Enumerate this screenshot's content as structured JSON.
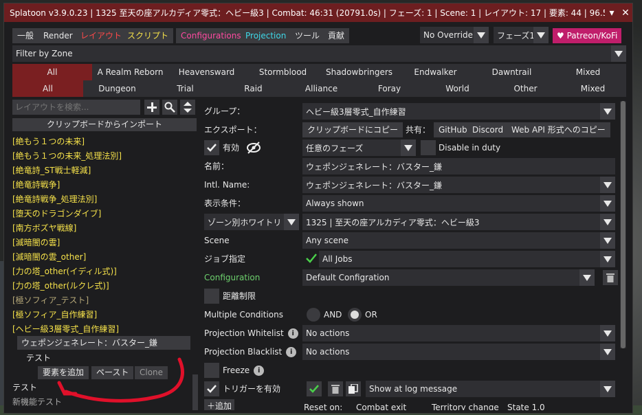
{
  "window": {
    "title": "Splatoon v3.9.0.23 | 1325 至天の座アルカディア零式：ヘビー級3 | Combat: 46:31 (20791.0s) | フェーズ: 1 | Scene: 1 | レイアウト: 17 | 要素: 44 | 96.5, 96.4"
  },
  "tabs": [
    {
      "label": "一般",
      "color": "#e8e8e8"
    },
    {
      "label": "Render",
      "color": "#e8e8e8"
    },
    {
      "label": "レイアウト",
      "color": "#ff4a4a"
    },
    {
      "label": "スクリプト",
      "color": "#f5e14a"
    },
    {
      "label": "Configurations",
      "color": "#ff4aa0"
    },
    {
      "label": "Projection",
      "color": "#3fd8e8"
    },
    {
      "label": "ツール",
      "color": "#e8e8e8"
    },
    {
      "label": "貢献",
      "color": "#e8e8e8"
    }
  ],
  "override_select": "No Override",
  "phase_select": "フェーズ1",
  "patreon": "♥ Patreon/KoFi",
  "filter_zone": "Filter by Zone",
  "zones_row1": [
    "All",
    "A Realm Reborn",
    "Heavensward",
    "Stormblood",
    "Shadowbringers",
    "Endwalker",
    "Dawntrail",
    "Mixed"
  ],
  "zones_row2": [
    "All",
    "Dungeon",
    "Trial",
    "Raid",
    "Alliance",
    "Foray",
    "World",
    "Other",
    "Mixed"
  ],
  "left": {
    "search_placeholder": "レイアウトを検索...",
    "import_clipboard": "クリップボードからインポート",
    "layouts": [
      {
        "label": "[絶もう１つの未来]",
        "dim": false
      },
      {
        "label": "[絶もう１つの未来_処理法別]",
        "dim": false
      },
      {
        "label": "[絶竜詩_ST戦士軽減]",
        "dim": false
      },
      {
        "label": "[絶竜詩戦争]",
        "dim": false
      },
      {
        "label": "[絶竜詩戦争_処理法別]",
        "dim": false
      },
      {
        "label": "[堕天のドラゴンダイブ]",
        "dim": false
      },
      {
        "label": "[南方ボズヤ戦線]",
        "dim": false
      },
      {
        "label": "[滅暗闇の雲]",
        "dim": false
      },
      {
        "label": "[滅暗闇の雲_other]",
        "dim": false
      },
      {
        "label": "[力の塔_other(イディル式)]",
        "dim": false
      },
      {
        "label": "[力の塔_other(ルクレ式)]",
        "dim": false
      },
      {
        "label": "[極ソフィア_テスト]",
        "dim": true
      },
      {
        "label": "[極ソフィア_自作練習]",
        "dim": false
      },
      {
        "label": "[ヘビー級3層零式_自作練習]",
        "dim": false
      }
    ],
    "selected_layout": "ウェポンジェネレート：バスター_鎌",
    "sub_element": "テスト",
    "add_element": "要素を追加",
    "paste": "ペースト",
    "clone": "Clone",
    "group_test": "テスト",
    "new_feature_test": "新機能テスト"
  },
  "right": {
    "group_label": "グループ：",
    "group_value": "ヘビー級3層零式_自作練習",
    "export_label": "エクスポート：",
    "copy_clipboard": "クリップボードにコピー",
    "share_label": "共有：",
    "github": "GitHub",
    "discord": "Discord",
    "webapi": "Web API 形式へのコピー",
    "enabled_label": "有効",
    "phase_any": "任意のフェーズ",
    "disable_duty": "Disable in duty",
    "name_label": "名前：",
    "name_value": "ウェポンジェネレート：バスター_鎌",
    "intl_label": "Intl. Name:",
    "intl_value": "ウェポンジェネレート：バスター_鎌",
    "display_cond_label": "表示条件：",
    "display_cond_value": "Always shown",
    "zone_whitelist": "ゾーン別ホワイトリ",
    "zone_value": "1325 | 至天の座アルカディア零式：ヘビー級3",
    "scene_label": "Scene",
    "scene_value": "Any scene",
    "job_label": "ジョブ指定",
    "job_value": "All Jobs",
    "config_label": "Configuration",
    "config_value": "Default Configration",
    "distance_label": "距離制限",
    "multi_label": "Multiple Conditions",
    "and_label": "AND",
    "or_label": "OR",
    "proj_white_label": "Projection Whitelist",
    "proj_white_value": "No actions",
    "proj_black_label": "Projection Blacklist",
    "proj_black_value": "No actions",
    "freeze_label": "Freeze",
    "trigger_label": "トリガーを有効",
    "trigger_value": "Show at log message",
    "add_label": "追加",
    "reset_on": "Reset on:",
    "combat_exit": "Combat exit",
    "territory_change": "Territory change",
    "state": "State 1.0"
  },
  "colors": {
    "titlebar": "#6d1e20",
    "accent": "#7a1f21",
    "annotation": "#e0102a"
  }
}
